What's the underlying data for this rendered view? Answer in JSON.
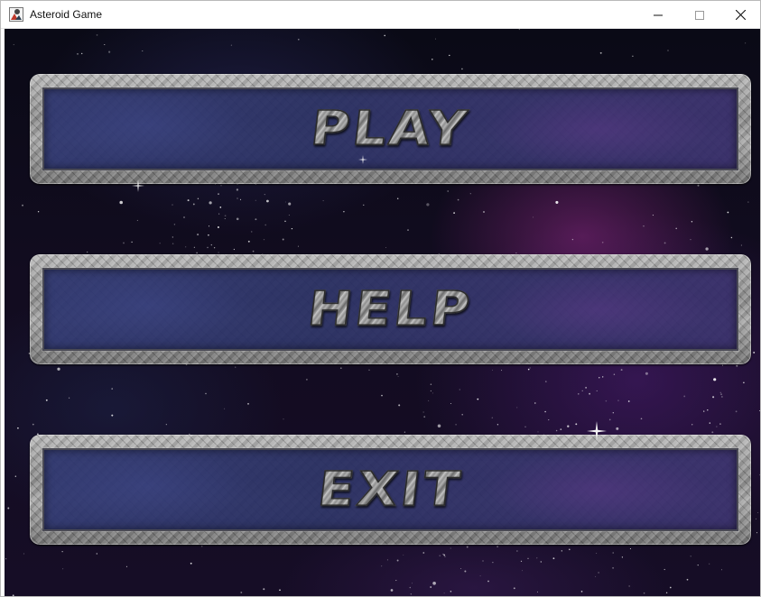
{
  "window": {
    "title": "Asteroid Game",
    "icon": "asteroid-game-app-icon",
    "controls": {
      "minimize_icon": "minimize-icon",
      "maximize_icon": "maximize-icon",
      "close_icon": "close-icon"
    }
  },
  "menu": {
    "buttons": [
      {
        "id": "play",
        "label": "PLAY"
      },
      {
        "id": "help",
        "label": "HELP"
      },
      {
        "id": "exit",
        "label": "EXIT"
      }
    ]
  },
  "colors": {
    "frame_metal": "#9a9a9a",
    "panel_blue": "#2c3470",
    "space_purple": "#3a1450",
    "nebula_magenta": "#8c2882"
  }
}
